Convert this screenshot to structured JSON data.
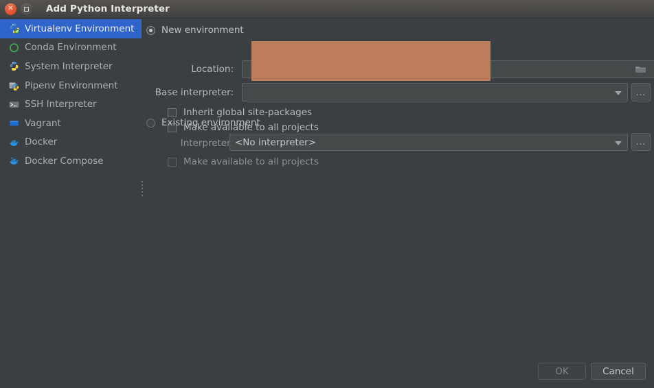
{
  "window": {
    "title": "Add Python Interpreter",
    "controls": [
      {
        "name": "close",
        "glyph": "✕"
      },
      {
        "name": "maximize",
        "glyph": ""
      }
    ]
  },
  "sidebar": {
    "items": [
      {
        "label": "Virtualenv Environment",
        "icon": "python-virtualenv-icon",
        "selected": true
      },
      {
        "label": "Conda Environment",
        "icon": "conda-icon",
        "selected": false
      },
      {
        "label": "System Interpreter",
        "icon": "python-icon",
        "selected": false
      },
      {
        "label": "Pipenv Environment",
        "icon": "pipenv-icon",
        "selected": false
      },
      {
        "label": "SSH Interpreter",
        "icon": "terminal-icon",
        "selected": false
      },
      {
        "label": "Vagrant",
        "icon": "vagrant-icon",
        "selected": false
      },
      {
        "label": "Docker",
        "icon": "docker-icon",
        "selected": false
      },
      {
        "label": "Docker Compose",
        "icon": "docker-compose-icon",
        "selected": false
      }
    ]
  },
  "main": {
    "new_environment": {
      "radio_label": "New environment",
      "selected": true,
      "location_label": "Location:",
      "location_value": "",
      "browse_icon": "folder-icon",
      "base_interpreter_label": "Base interpreter:",
      "base_interpreter_value": "",
      "more_button_label": "...",
      "inherit_label": "Inherit global site-packages",
      "inherit_checked": false,
      "make_available_label": "Make available to all projects",
      "make_available_checked": false
    },
    "existing_environment": {
      "radio_label": "Existing environment",
      "selected": false,
      "interpreter_label": "Interpreter:",
      "interpreter_value": "<No interpreter>",
      "more_button_label": "...",
      "make_available_label": "Make available to all projects",
      "make_available_checked": false
    }
  },
  "footer": {
    "ok_label": "OK",
    "ok_enabled": false,
    "cancel_label": "Cancel",
    "cancel_enabled": true
  },
  "colors": {
    "background": "#3c3f41",
    "selection": "#2f65ca",
    "overlay": "#bd7c5a",
    "text": "#b4babe"
  }
}
